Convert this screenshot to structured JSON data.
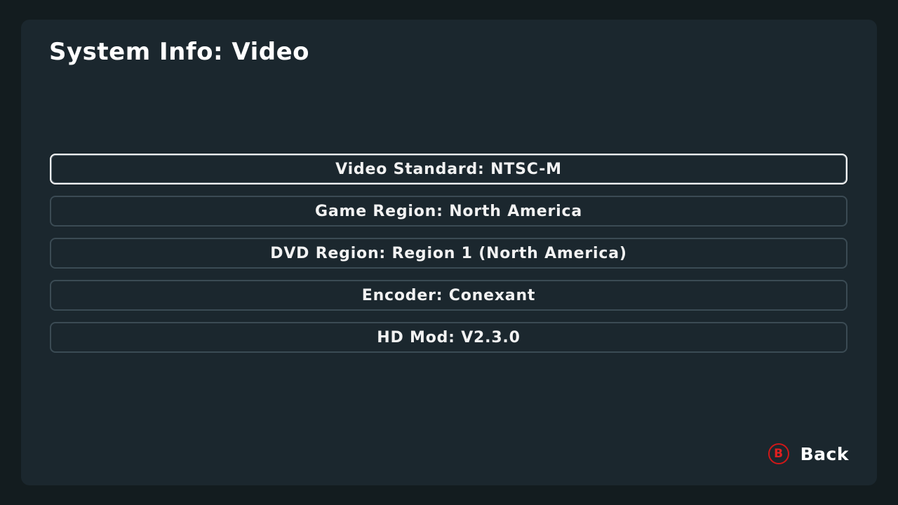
{
  "header": {
    "title": "System Info: Video"
  },
  "menu": {
    "items": [
      {
        "label": "Video Standard: NTSC-M",
        "selected": true
      },
      {
        "label": "Game Region: North America",
        "selected": false
      },
      {
        "label": "DVD Region: Region 1 (North America)",
        "selected": false
      },
      {
        "label": "Encoder: Conexant",
        "selected": false
      },
      {
        "label": "HD Mod: V2.3.0",
        "selected": false
      }
    ]
  },
  "footer": {
    "back_button_glyph": "B",
    "back_label": "Back",
    "back_button_icon": "b-button-icon",
    "back_button_color": "#d01818"
  },
  "colors": {
    "background": "#131c1f",
    "panel": "#1b272e",
    "item_border": "#3b4b54",
    "selected_border": "#f4f4f4",
    "text": "#ffffff"
  }
}
